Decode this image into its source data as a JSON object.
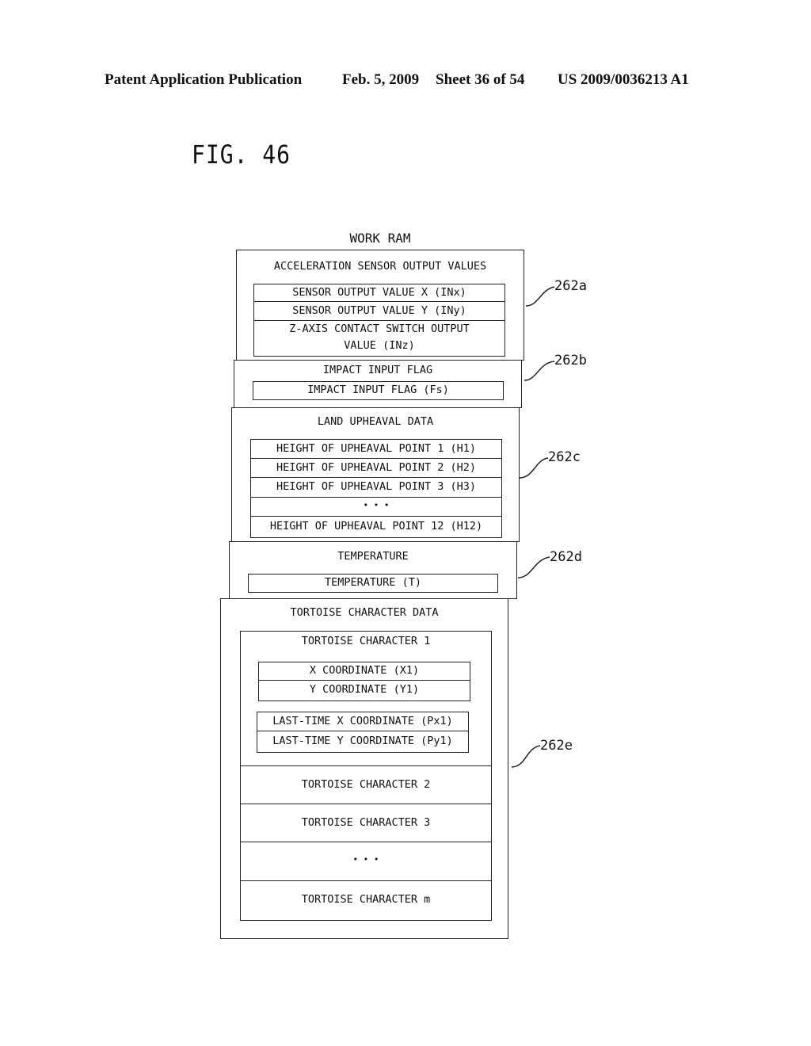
{
  "header": {
    "publication": "Patent Application Publication",
    "date": "Feb. 5, 2009",
    "sheet": "Sheet 36 of 54",
    "number": "US 2009/0036213 A1"
  },
  "figure_label": "FIG. 46",
  "diagram": {
    "title": "WORK RAM",
    "sections": [
      {
        "ref": "262a",
        "title": "ACCELERATION SENSOR OUTPUT VALUES",
        "rows": [
          "SENSOR OUTPUT VALUE X (INx)",
          "SENSOR OUTPUT VALUE Y (INy)",
          "Z-AXIS CONTACT SWITCH OUTPUT",
          "VALUE (INz)"
        ]
      },
      {
        "ref": "262b",
        "title": "IMPACT INPUT FLAG",
        "rows": [
          "IMPACT INPUT FLAG (Fs)"
        ]
      },
      {
        "ref": "262c",
        "title": "LAND UPHEAVAL DATA",
        "rows": [
          "HEIGHT OF UPHEAVAL POINT 1 (H1)",
          "HEIGHT OF UPHEAVAL POINT 2 (H2)",
          "HEIGHT OF UPHEAVAL POINT 3 (H3)",
          "• • •",
          "HEIGHT OF UPHEAVAL POINT 12 (H12)"
        ]
      },
      {
        "ref": "262d",
        "title": "TEMPERATURE",
        "rows": [
          "TEMPERATURE (T)"
        ]
      },
      {
        "ref": "262e",
        "title": "TORTOISE CHARACTER DATA",
        "character1": {
          "title": "TORTOISE CHARACTER 1",
          "coords": [
            "X COORDINATE (X1)",
            "Y COORDINATE (Y1)"
          ],
          "last_coords": [
            "LAST-TIME X COORDINATE (Px1)",
            "LAST-TIME Y COORDINATE (Py1)"
          ]
        },
        "rows": [
          "TORTOISE CHARACTER 2",
          "TORTOISE CHARACTER 3",
          "• • •",
          "TORTOISE CHARACTER m"
        ]
      }
    ]
  }
}
